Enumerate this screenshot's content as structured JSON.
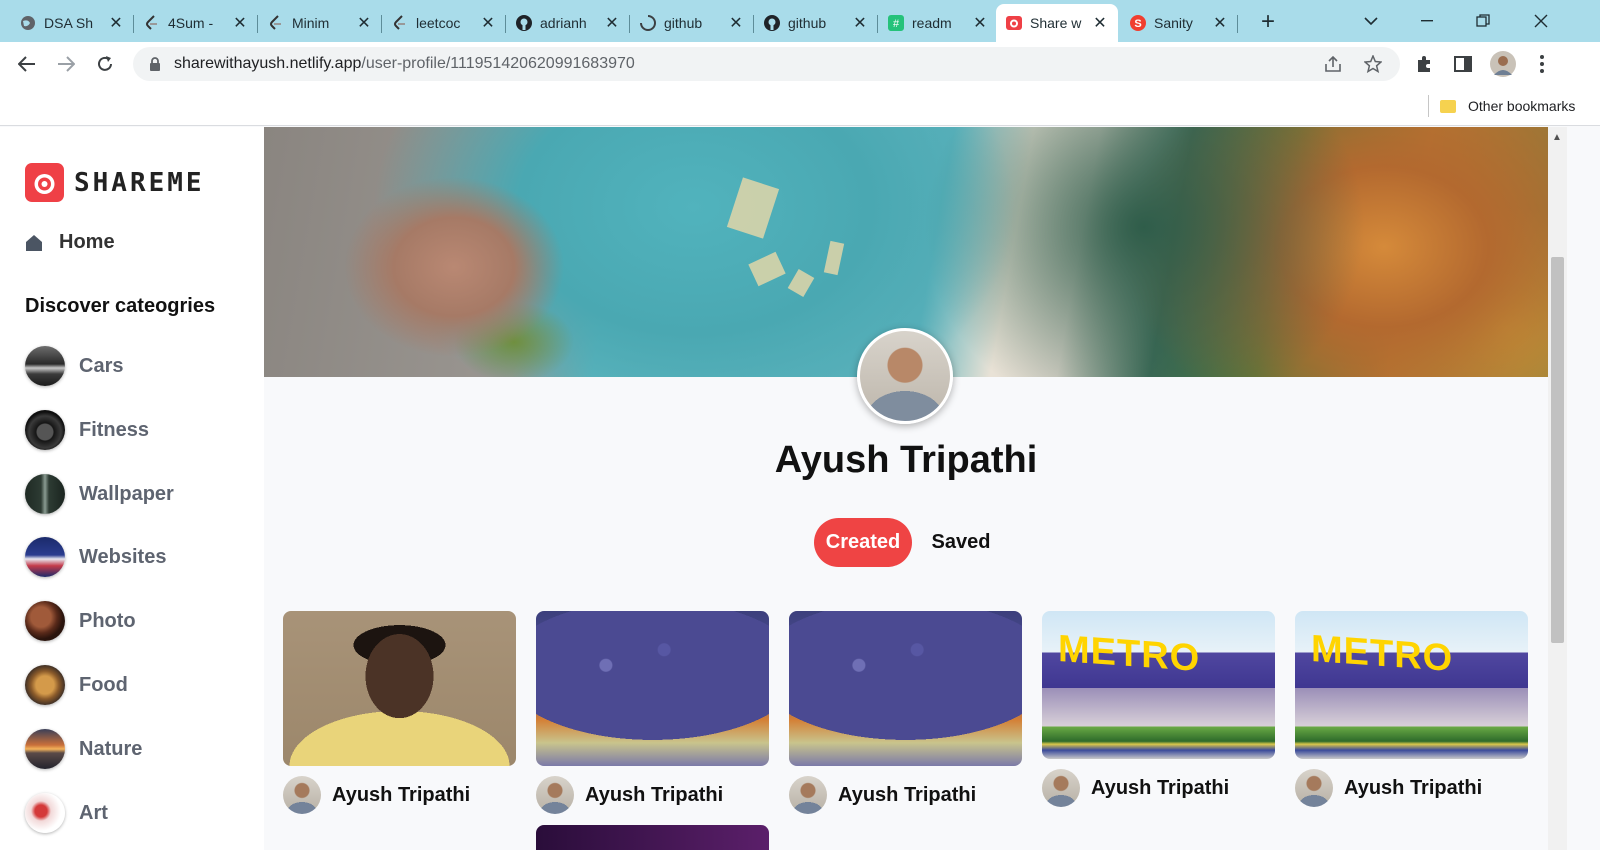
{
  "browser": {
    "tabs": [
      {
        "label": "DSA Sh",
        "icon": "globe-icon"
      },
      {
        "label": "4Sum -",
        "icon": "leetcode-icon"
      },
      {
        "label": "Minim",
        "icon": "leetcode-icon"
      },
      {
        "label": "leetcoc",
        "icon": "leetcode-icon"
      },
      {
        "label": "adrianh",
        "icon": "github-icon"
      },
      {
        "label": "github",
        "icon": "github-loading-icon"
      },
      {
        "label": "github",
        "icon": "github-icon"
      },
      {
        "label": "readm",
        "icon": "readme-icon"
      },
      {
        "label": "Share w",
        "icon": "shareme-icon",
        "active": true
      },
      {
        "label": "Sanity",
        "icon": "sanity-icon"
      }
    ],
    "url_host": "sharewithayush.netlify.app",
    "url_path": "/user-profile/111951420620991683970",
    "bookmarks": {
      "other_label": "Other bookmarks"
    },
    "colors": {
      "tabstrip": "#a9dcea",
      "omnibox": "#f1f3f4"
    }
  },
  "sidebar": {
    "logo_text": "SHAREME",
    "home_label": "Home",
    "categories_title": "Discover cateogries",
    "categories": [
      {
        "label": "Cars"
      },
      {
        "label": "Fitness"
      },
      {
        "label": "Wallpaper"
      },
      {
        "label": "Websites"
      },
      {
        "label": "Photo"
      },
      {
        "label": "Food"
      },
      {
        "label": "Nature"
      },
      {
        "label": "Art"
      }
    ]
  },
  "profile": {
    "name": "Ayush Tripathi",
    "tabs": {
      "created": "Created",
      "saved": "Saved"
    },
    "accent_color": "#ef4444"
  },
  "pins": [
    {
      "user": "Ayush Tripathi",
      "image": "portrait-photo"
    },
    {
      "user": "Ayush Tripathi",
      "image": "grapes-photo"
    },
    {
      "user": "Ayush Tripathi",
      "image": "grapes-photo"
    },
    {
      "user": "Ayush Tripathi",
      "image": "metro-store-photo",
      "sign": "METRO"
    },
    {
      "user": "Ayush Tripathi",
      "image": "metro-store-photo",
      "sign": "METRO"
    }
  ]
}
